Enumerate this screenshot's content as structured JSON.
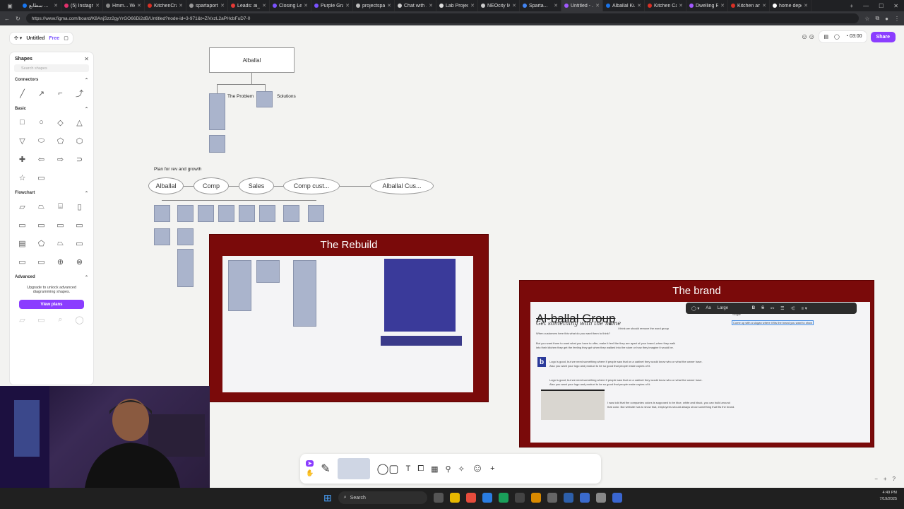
{
  "browser": {
    "tabs": [
      {
        "label": "سطابع ...",
        "color": "#1877f2"
      },
      {
        "label": "(5) Instagr...",
        "color": "#e1306c"
      },
      {
        "label": "Hmm... We...",
        "color": "#888888"
      },
      {
        "label": "KitchenCra...",
        "color": "#d93025"
      },
      {
        "label": "spartaport...",
        "color": "#999999"
      },
      {
        "label": "Leads: ai_lo...",
        "color": "#e53935"
      },
      {
        "label": "Closing Le...",
        "color": "#7a52ff"
      },
      {
        "label": "Purple Gra...",
        "color": "#7a52ff"
      },
      {
        "label": "projectspar...",
        "color": "#bbbbbb"
      },
      {
        "label": "Chat with ...",
        "color": "#cccccc"
      },
      {
        "label": "Lab Projec...",
        "color": "#dddddd"
      },
      {
        "label": "NEOcity M...",
        "color": "#cccccc"
      },
      {
        "label": "Sparta...",
        "color": "#4285f4"
      },
      {
        "label": "Untitled - ...",
        "color": "#a259ff"
      },
      {
        "label": "Alballal Ki...",
        "color": "#1a73e8"
      },
      {
        "label": "Kitchen Ca...",
        "color": "#d93025"
      },
      {
        "label": "Dwelling R...",
        "color": "#a259ff"
      },
      {
        "label": "Kitchen an...",
        "color": "#d93025"
      },
      {
        "label": "home depo...",
        "color": "#ffffff"
      }
    ],
    "url": "https://www.figma.com/board/K8AnjSzz2gyYrGO66Di2dB/Untitled?node-id=3-971&t=ZiVxzL2aPHcbFuD7-0"
  },
  "topbar": {
    "file_name": "Untitled",
    "plan": "Free",
    "timer": "03:00",
    "share_label": "Share"
  },
  "panel": {
    "title": "Shapes",
    "search_placeholder": "Search shapes",
    "sections": {
      "connectors": "Connectors",
      "basic": "Basic",
      "flowchart": "Flowchart",
      "advanced": "Advanced"
    },
    "upgrade_text": "Upgrade to unlock advanced diagramming shapes.",
    "view_plans": "View plans"
  },
  "board": {
    "root": "Alballal",
    "problem": "The Problem",
    "solutions": "Solutions",
    "plan_label": "Plan for rev and growth",
    "flow": [
      "Alballal",
      "Comp",
      "Sales",
      "Comp cust...",
      "Alballal Cus..."
    ],
    "rebuild_title": "The Rebuild",
    "brand_title": "The brand",
    "brand_heading": "Al-ballal Group",
    "brand_handwriting": "Get something with the name",
    "brand_note": "I think we should remove the word group",
    "brand_slogan_label": "Slogan",
    "brand_slogan_box": "Come up with a slogan where it fits the brand you want to show",
    "brand_p1": "When customers here this what do you want them to think?",
    "brand_p2": "But you want them to want what you have to offer, make it feel like they are apart of your brand, when they walk",
    "brand_p2b": "into their kitchen they get the feeling they got when they walked into the store or how they imagine it would be.",
    "brand_p3": "Logo is good, but we need something where if people saw that on a cabinet they would know who or what the owner have.",
    "brand_p3b": "Also you want your logo and product to be so good that people make copies of it.",
    "brand_p4": "Logo is good, but we need something where if people saw that on a cabinet they would know who or what the owner have.",
    "brand_p4b": "Also you want your logo and product to be so good that people make copies of it.",
    "brand_p5": "I was told that the companies colors is supposed to be blue, white and black, you can build around",
    "brand_p5b": "that color. But website has to show that, employees should always show something that fits the brand."
  },
  "format_toolbar": {
    "font_size": "Large",
    "text_label": "Aa"
  },
  "taskbar": {
    "search": "Search",
    "time": "4:49 PM",
    "date": "7/19/2025"
  }
}
